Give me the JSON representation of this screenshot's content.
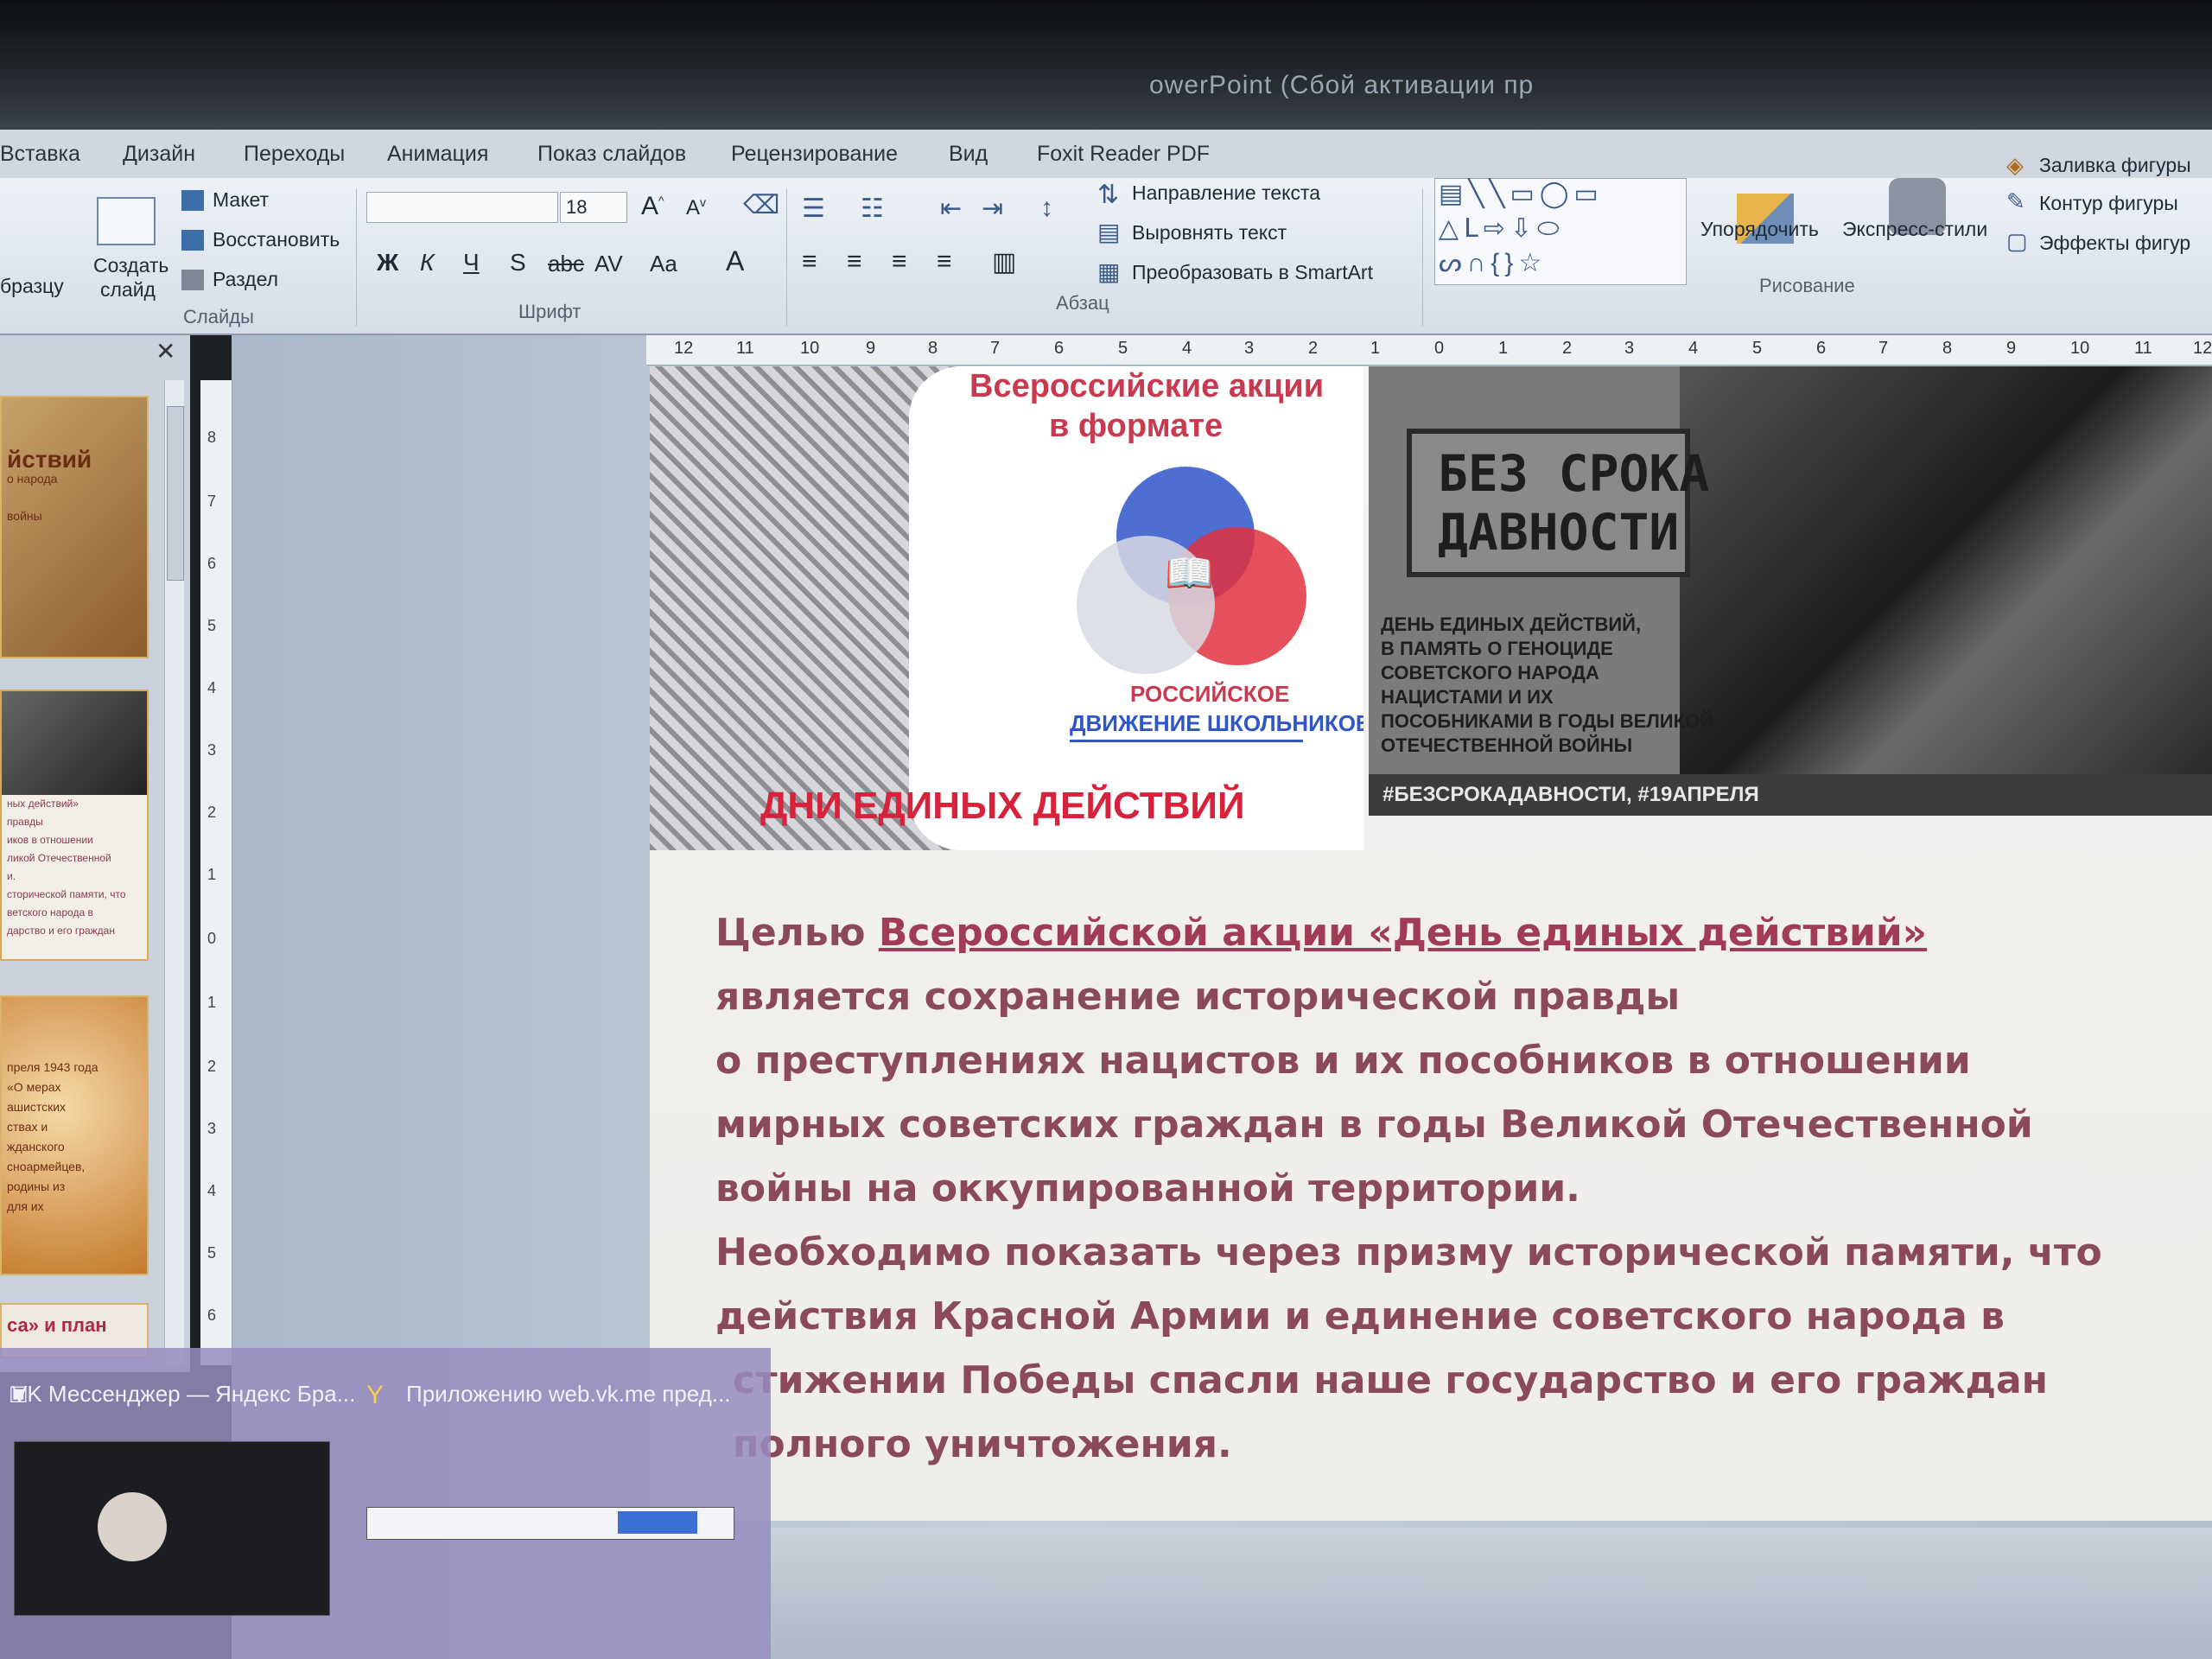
{
  "window": {
    "title": "owerPoint (Сбой активации пр"
  },
  "tabs": [
    "Вставка",
    "Дизайн",
    "Переходы",
    "Анимация",
    "Показ слайдов",
    "Рецензирование",
    "Вид",
    "Foxit Reader PDF"
  ],
  "ribbon": {
    "slides": {
      "partial_label": "бразцу",
      "create_label": "Создать",
      "create_label2": "слайд",
      "layout_label": "Макет",
      "restore_label": "Восстановить",
      "section_label": "Раздел",
      "group_label": "Слайды"
    },
    "font": {
      "font_size": "18",
      "bold": "Ж",
      "italic": "К",
      "underline": "Ч",
      "shadow": "S",
      "strike": "abc",
      "spacing": "AV",
      "case": "Aa",
      "color": "A",
      "group_label": "Шрифт"
    },
    "paragraph": {
      "direction_label": "Направление текста",
      "align_label": "Выровнять текст",
      "smartart_label": "Преобразовать в SmartArt",
      "group_label": "Абзац"
    },
    "drawing": {
      "arrange_label": "Упорядочить",
      "styles_label": "Экспресс-стили",
      "fill_label": "Заливка фигуры",
      "outline_label": "Контур фигуры",
      "effects_label": "Эффекты фигур",
      "group_label": "Рисование"
    }
  },
  "ruler": {
    "horizontal": [
      "12",
      "11",
      "10",
      "9",
      "8",
      "7",
      "6",
      "5",
      "4",
      "3",
      "2",
      "1",
      "0",
      "1",
      "2",
      "3",
      "4",
      "5",
      "6",
      "7",
      "8",
      "9",
      "10",
      "11",
      "12"
    ],
    "vertical": [
      "8",
      "7",
      "6",
      "5",
      "4",
      "3",
      "2",
      "1",
      "0",
      "1",
      "2",
      "3",
      "4",
      "5",
      "6"
    ]
  },
  "thumbnails": [
    {
      "lines": [
        "йствий",
        "о народа",
        "войны"
      ]
    },
    {
      "lines": [
        "ных действий»",
        "правды",
        "иков в отношении",
        "ликой Отечественной",
        "и.",
        "сторической памяти, что",
        "ветского народа в",
        "дарство и его граждан"
      ]
    },
    {
      "lines": [
        "преля 1943 года",
        "«О мерах",
        "ашистских",
        "ствах и",
        "жданского",
        "сноармейцев,",
        "родины из",
        "для их"
      ]
    },
    {
      "lines": [
        "са» и план"
      ]
    }
  ],
  "slide": {
    "banner_left": {
      "title_line1": "Всероссийские акции",
      "title_line2": "в формате",
      "logo_line1": "РОССИЙСКОЕ",
      "logo_line2": "ДВИЖЕНИЕ ШКОЛЬНИКОВ",
      "bottom": "ДНИ ЕДИНЫХ ДЕЙСТВИЙ"
    },
    "banner_right": {
      "stamp_line1": "БЕЗ СРОКА",
      "stamp_line2": "ДАВНОСТИ",
      "desc": [
        "ДЕНЬ ЕДИНЫХ ДЕЙСТВИЙ,",
        "В ПАМЯТЬ О ГЕНОЦИДЕ",
        "СОВЕТСКОГО НАРОДА",
        "НАЦИСТАМИ И ИХ",
        "ПОСОБНИКАМИ В ГОДЫ ВЕЛИКОЙ",
        "ОТЕЧЕСТВЕННОЙ ВОЙНЫ"
      ],
      "hashtags": "#БЕЗСРОКАДАВНОСТИ, #19АПРЕЛЯ"
    },
    "body": {
      "line1_prefix": "Целью ",
      "line1_underlined": "Всероссийской акции «День единых действий»",
      "lines": [
        "является  сохранение исторической правды",
        " о преступлениях нацистов и их пособников в отношении",
        "мирных советских граждан в годы Великой Отечественной",
        "войны на оккупированной территории.",
        "Необходимо показать через призму исторической памяти, что",
        "действия Красной Армии и единение советского народа в",
        "стижении Победы спасли наше государство и его граждан",
        " полного уничтожения."
      ]
    }
  },
  "taskbar_popup": {
    "item1": "VK Мессенджер — Яндекс Бра...",
    "item2": "Приложению web.vk.me пред..."
  }
}
